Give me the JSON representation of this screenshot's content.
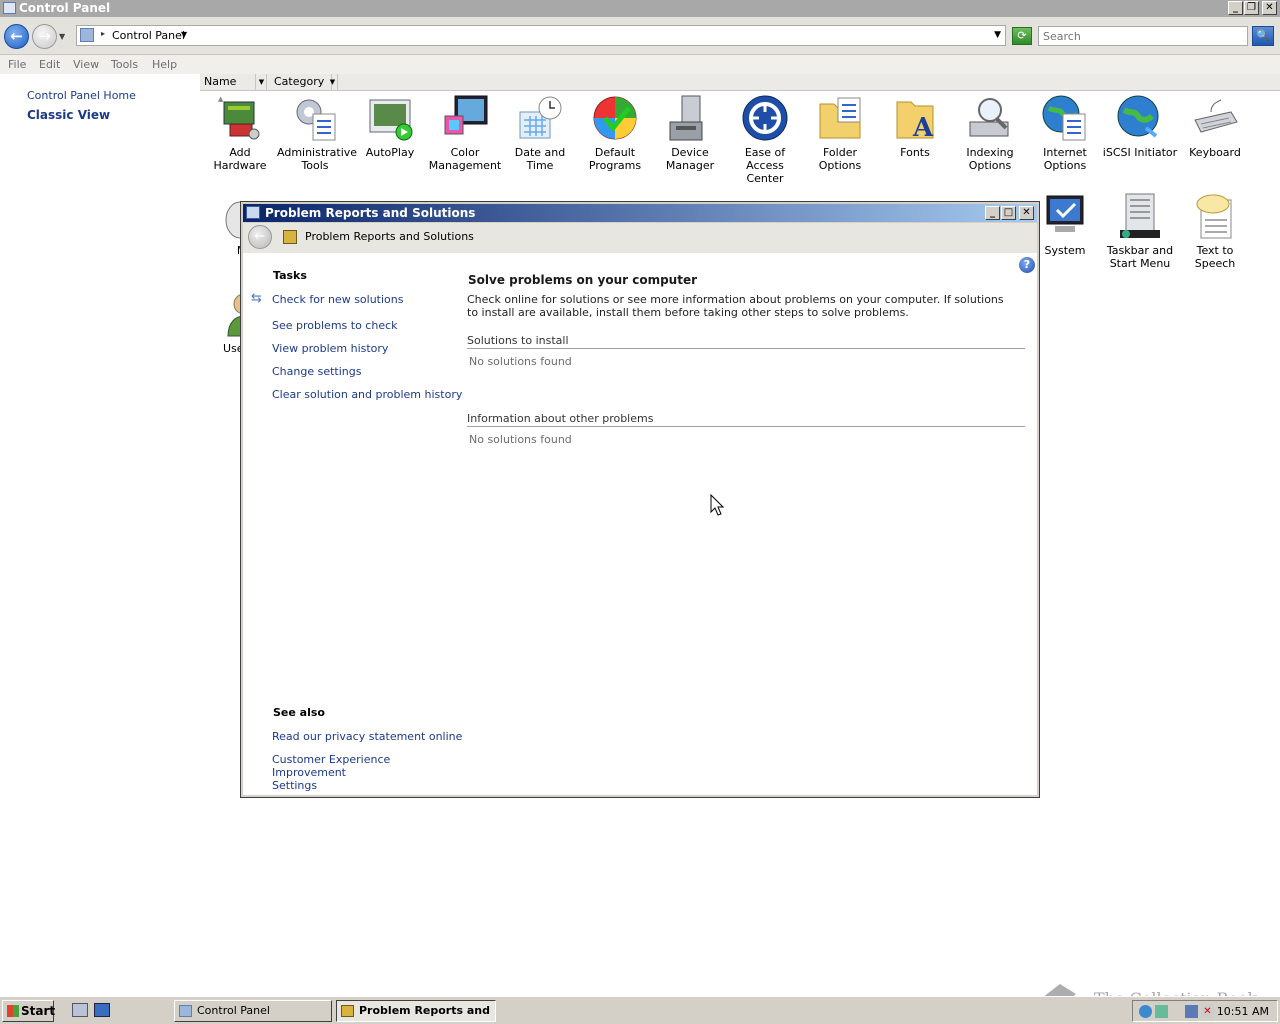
{
  "control_panel": {
    "window_title": "Control Panel",
    "address_crumb": "Control Panel",
    "search_placeholder": "Search",
    "menu": [
      "File",
      "Edit",
      "View",
      "Tools",
      "Help"
    ],
    "left_links": {
      "home": "Control Panel Home",
      "classic": "Classic View"
    },
    "columns": {
      "name": "Name",
      "category": "Category"
    },
    "items_row1": [
      {
        "label": "Add Hardware",
        "icon": "add-hardware-icon"
      },
      {
        "label": "Administrative Tools",
        "icon": "admin-tools-icon"
      },
      {
        "label": "AutoPlay",
        "icon": "autoplay-icon"
      },
      {
        "label": "Color Management",
        "icon": "color-management-icon"
      },
      {
        "label": "Date and Time",
        "icon": "date-time-icon"
      },
      {
        "label": "Default Programs",
        "icon": "default-programs-icon"
      },
      {
        "label": "Device Manager",
        "icon": "device-manager-icon"
      },
      {
        "label": "Ease of Access Center",
        "icon": "ease-of-access-icon"
      },
      {
        "label": "Folder Options",
        "icon": "folder-options-icon"
      },
      {
        "label": "Fonts",
        "icon": "fonts-icon"
      },
      {
        "label": "Indexing Options",
        "icon": "indexing-options-icon"
      },
      {
        "label": "Internet Options",
        "icon": "internet-options-icon"
      },
      {
        "label": "iSCSI Initiator",
        "icon": "iscsi-icon"
      },
      {
        "label": "Keyboard",
        "icon": "keyboard-icon"
      }
    ],
    "items_row2_visible": [
      {
        "label": "Mo",
        "icon": "mouse-icon"
      },
      {
        "label": "System",
        "icon": "system-icon"
      },
      {
        "label": "Taskbar and Start Menu",
        "icon": "taskbar-icon"
      },
      {
        "label": "Text to Speech",
        "icon": "text-to-speech-icon"
      }
    ],
    "items_row3_visible": [
      {
        "label": "User Ac",
        "icon": "user-accounts-icon"
      }
    ]
  },
  "dialog": {
    "title": "Problem Reports and Solutions",
    "crumb": "Problem Reports and Solutions",
    "tasks_heading": "Tasks",
    "tasks": [
      "Check for new solutions",
      "See problems to check",
      "View problem history",
      "Change settings",
      "Clear solution and problem history"
    ],
    "see_also_heading": "See also",
    "see_also": [
      "Read our privacy statement online",
      "Customer Experience Improvement Settings"
    ],
    "main_title": "Solve problems on your computer",
    "main_description": "Check online for solutions or see more information about problems on your computer. If solutions to install are available, install them before taking other steps to solve problems.",
    "sections": [
      {
        "heading": "Solutions to install",
        "empty_text": "No solutions found"
      },
      {
        "heading": "Information about other problems",
        "empty_text": "No solutions found"
      }
    ]
  },
  "taskbar": {
    "start_label": "Start",
    "tasks": [
      "Control Panel",
      "Problem Reports and ..."
    ],
    "clock": "10:51 AM"
  },
  "watermark": "The Collection Book"
}
